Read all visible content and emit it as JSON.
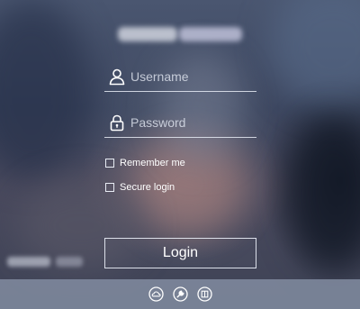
{
  "header": {
    "title_obscured": true
  },
  "login_form": {
    "username": {
      "icon": "user-icon",
      "placeholder": "Username",
      "value": ""
    },
    "password": {
      "icon": "lock-icon",
      "placeholder": "Password",
      "value": ""
    },
    "options": [
      {
        "label": "Remember me",
        "checked": false
      },
      {
        "label": "Secure login",
        "checked": false
      }
    ],
    "login_label": "Login"
  },
  "bottom_bar": {
    "icons": [
      "cloud-icon",
      "wrench-icon",
      "book-icon"
    ]
  },
  "colors": {
    "text": "#ffffff",
    "line": "#e6ebf5",
    "bottom_bar": "#808a9e",
    "background": "#3d4760"
  }
}
